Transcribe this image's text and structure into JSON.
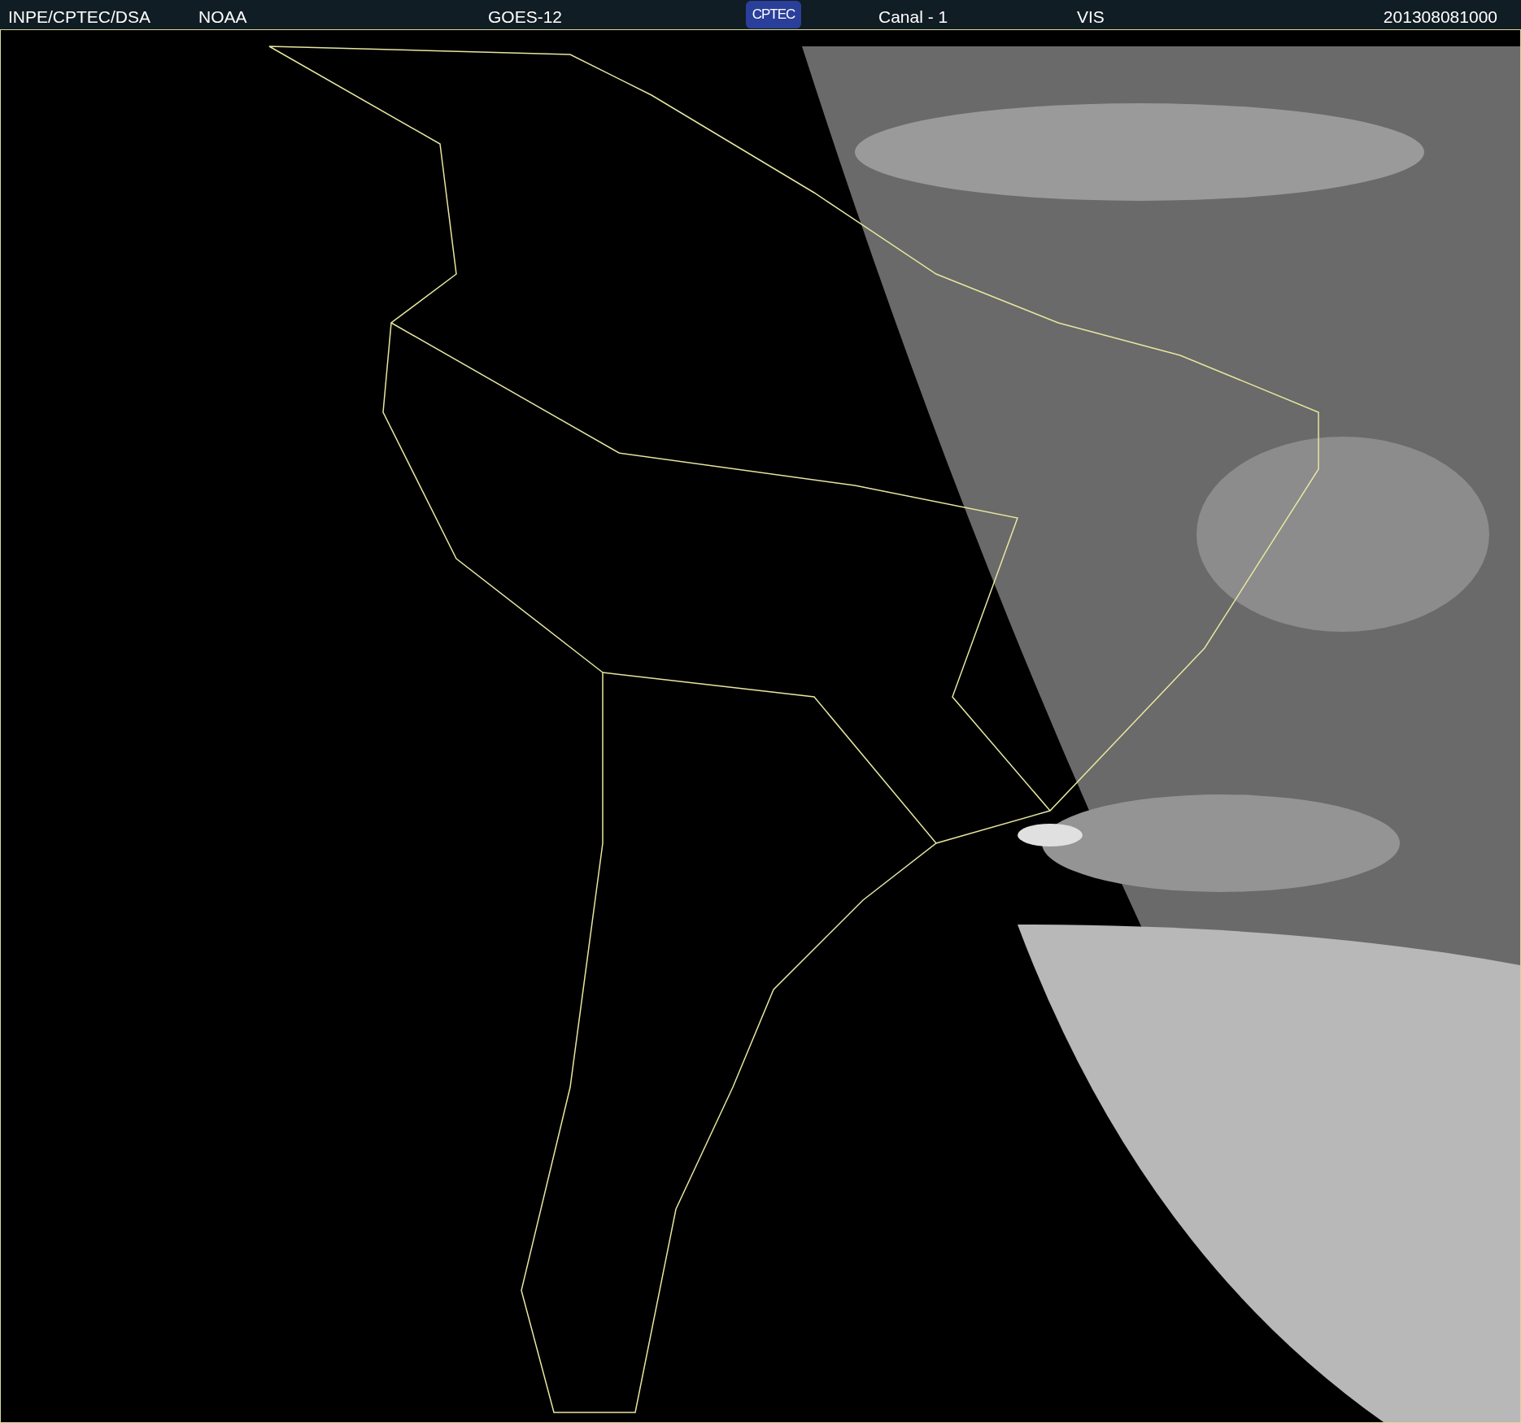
{
  "header": {
    "source": "INPE/CPTEC/DSA",
    "agency": "NOAA",
    "satellite": "GOES-12",
    "logo": "CPTEC",
    "channel": "Canal - 1",
    "band": "VIS",
    "timestamp": "201308081000"
  }
}
